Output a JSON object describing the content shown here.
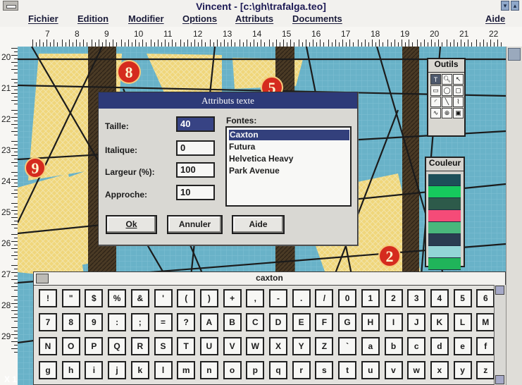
{
  "window": {
    "title": "Vincent - [c:\\gh\\trafalga.teo]",
    "menu": [
      "Fichier",
      "Edition",
      "Modifier",
      "Options",
      "Attributs",
      "Documents",
      "Aide"
    ]
  },
  "rulers": {
    "horizontal": [
      "7",
      "8",
      "9",
      "10",
      "11",
      "12",
      "13",
      "14",
      "15",
      "16",
      "17",
      "18",
      "19",
      "20",
      "21",
      "22"
    ],
    "vertical": [
      "20",
      "21",
      "22",
      "23",
      "24",
      "25",
      "26",
      "27",
      "28",
      "29"
    ]
  },
  "tool_palette": {
    "title": "Outils",
    "tools": [
      "pointer",
      "zoom",
      "arrow",
      "rectangle",
      "ellipse",
      "rounded-rect",
      "curve",
      "line",
      "polygon",
      "bezier",
      "pen",
      "fill"
    ]
  },
  "color_palette": {
    "title": "Couleur",
    "swatches": [
      "#1d4f59",
      "#16c95d",
      "#2d5a4a",
      "#f54b78",
      "#49b77c",
      "#2a3c51",
      "#93d5d6",
      "#20b45a"
    ]
  },
  "dialog": {
    "title": "Attributs texte",
    "labels": {
      "taille": "Taille:",
      "italique": "Italique:",
      "largeur": "Largeur (%):",
      "approche": "Approche:",
      "fontes": "Fontes:"
    },
    "values": {
      "taille": "40",
      "italique": "0",
      "largeur": "100",
      "approche": "10"
    },
    "fonts": [
      "Caxton",
      "Futura",
      "Helvetica Heavy",
      "Park Avenue"
    ],
    "selected_font": "Caxton",
    "buttons": {
      "ok": "Ok",
      "cancel": "Annuler",
      "help": "Aide"
    }
  },
  "char_palette": {
    "title": "caxton",
    "rows": [
      [
        "!",
        "\"",
        "$",
        "%",
        "&",
        "'",
        "(",
        ")",
        "+",
        ",",
        "-",
        ".",
        "/",
        "0",
        "1",
        "2",
        "3",
        "4",
        "5",
        "6"
      ],
      [
        "7",
        "8",
        "9",
        ":",
        ";",
        "=",
        "?",
        "A",
        "B",
        "C",
        "D",
        "E",
        "F",
        "G",
        "H",
        "I",
        "J",
        "K",
        "L",
        "M"
      ],
      [
        "N",
        "O",
        "P",
        "Q",
        "R",
        "S",
        "T",
        "U",
        "V",
        "W",
        "X",
        "Y",
        "Z",
        "`",
        "a",
        "b",
        "c",
        "d",
        "e",
        "f"
      ],
      [
        "g",
        "h",
        "i",
        "j",
        "k",
        "l",
        "m",
        "n",
        "o",
        "p",
        "q",
        "r",
        "s",
        "t",
        "u",
        "v",
        "w",
        "x",
        "y",
        "z"
      ]
    ]
  },
  "canvas": {
    "markers": [
      "8",
      "5",
      "9",
      "2"
    ]
  },
  "status": {
    "corner_left": "X 1"
  }
}
